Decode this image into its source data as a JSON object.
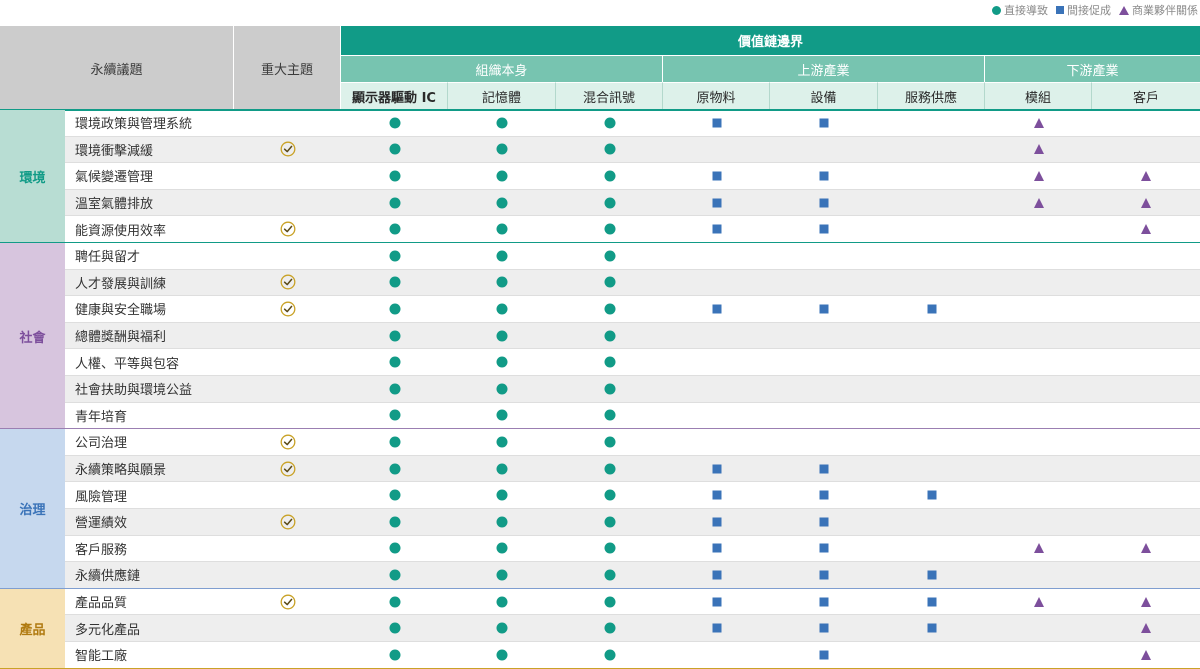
{
  "legend": [
    {
      "shape": "circle",
      "label": "直接導致"
    },
    {
      "shape": "square",
      "label": "間接促成"
    },
    {
      "shape": "triangle",
      "label": "商業夥伴關係"
    }
  ],
  "header": {
    "topic_label": "永續議題",
    "material_label": "重大主題",
    "value_chain_label": "價值鏈邊界",
    "groups": [
      "組織本身",
      "上游產業",
      "下游產業"
    ],
    "columns": [
      "顯示器驅動 IC",
      "記憶體",
      "混合訊號",
      "原物料",
      "設備",
      "服務供應",
      "模組",
      "客戶"
    ]
  },
  "colors": {
    "primary_teal": "#119b87",
    "direct": "#119b87",
    "indirect": "#3a73b8",
    "partner": "#7d4f9c",
    "material_check": "#c9a227"
  },
  "categories": [
    {
      "name": "環境",
      "bg": "#b8ddd3",
      "text": "#119b87",
      "line": "#119b87",
      "rows": [
        0,
        4
      ]
    },
    {
      "name": "社會",
      "bg": "#d7c5de",
      "text": "#7d4f9c",
      "line": "#9b7fb2",
      "rows": [
        5,
        11
      ]
    },
    {
      "name": "治理",
      "bg": "#c6d8ee",
      "text": "#3a73b8",
      "line": "#7f9ed0",
      "rows": [
        12,
        17
      ]
    },
    {
      "name": "產品",
      "bg": "#f6e1b4",
      "text": "#b07a10",
      "line": "#c9a227",
      "rows": [
        18,
        20
      ]
    }
  ],
  "rows": [
    {
      "topic": "環境政策與管理系統",
      "material": false,
      "marks": [
        "C",
        "C",
        "C",
        "S",
        "S",
        "",
        "T",
        ""
      ]
    },
    {
      "topic": "環境衝擊減緩",
      "material": true,
      "marks": [
        "C",
        "C",
        "C",
        "",
        "",
        "",
        "T",
        ""
      ]
    },
    {
      "topic": "氣候變遷管理",
      "material": false,
      "marks": [
        "C",
        "C",
        "C",
        "S",
        "S",
        "",
        "T",
        "T"
      ]
    },
    {
      "topic": "溫室氣體排放",
      "material": false,
      "marks": [
        "C",
        "C",
        "C",
        "S",
        "S",
        "",
        "T",
        "T"
      ]
    },
    {
      "topic": "能資源使用效率",
      "material": true,
      "marks": [
        "C",
        "C",
        "C",
        "S",
        "S",
        "",
        "",
        "T"
      ]
    },
    {
      "topic": "聘任與留才",
      "material": false,
      "marks": [
        "C",
        "C",
        "C",
        "",
        "",
        "",
        "",
        ""
      ]
    },
    {
      "topic": "人才發展與訓練",
      "material": true,
      "marks": [
        "C",
        "C",
        "C",
        "",
        "",
        "",
        "",
        ""
      ]
    },
    {
      "topic": "健康與安全職場",
      "material": true,
      "marks": [
        "C",
        "C",
        "C",
        "S",
        "S",
        "S",
        "",
        ""
      ]
    },
    {
      "topic": "總體獎酬與福利",
      "material": false,
      "marks": [
        "C",
        "C",
        "C",
        "",
        "",
        "",
        "",
        ""
      ]
    },
    {
      "topic": "人權、平等與包容",
      "material": false,
      "marks": [
        "C",
        "C",
        "C",
        "",
        "",
        "",
        "",
        ""
      ]
    },
    {
      "topic": "社會扶助與環境公益",
      "material": false,
      "marks": [
        "C",
        "C",
        "C",
        "",
        "",
        "",
        "",
        ""
      ]
    },
    {
      "topic": "青年培育",
      "material": false,
      "marks": [
        "C",
        "C",
        "C",
        "",
        "",
        "",
        "",
        ""
      ]
    },
    {
      "topic": "公司治理",
      "material": true,
      "marks": [
        "C",
        "C",
        "C",
        "",
        "",
        "",
        "",
        ""
      ]
    },
    {
      "topic": "永續策略與願景",
      "material": true,
      "marks": [
        "C",
        "C",
        "C",
        "S",
        "S",
        "",
        "",
        ""
      ]
    },
    {
      "topic": "風險管理",
      "material": false,
      "marks": [
        "C",
        "C",
        "C",
        "S",
        "S",
        "S",
        "",
        ""
      ]
    },
    {
      "topic": "營運績效",
      "material": true,
      "marks": [
        "C",
        "C",
        "C",
        "S",
        "S",
        "",
        "",
        ""
      ]
    },
    {
      "topic": "客戶服務",
      "material": false,
      "marks": [
        "C",
        "C",
        "C",
        "S",
        "S",
        "",
        "T",
        "T"
      ]
    },
    {
      "topic": "永續供應鏈",
      "material": false,
      "marks": [
        "C",
        "C",
        "C",
        "S",
        "S",
        "S",
        "",
        ""
      ]
    },
    {
      "topic": "產品品質",
      "material": true,
      "marks": [
        "C",
        "C",
        "C",
        "S",
        "S",
        "S",
        "T",
        "T"
      ]
    },
    {
      "topic": "多元化產品",
      "material": false,
      "marks": [
        "C",
        "C",
        "C",
        "S",
        "S",
        "S",
        "",
        "T"
      ]
    },
    {
      "topic": "智能工廠",
      "material": false,
      "marks": [
        "C",
        "C",
        "C",
        "",
        "S",
        "",
        "",
        "T"
      ]
    }
  ]
}
